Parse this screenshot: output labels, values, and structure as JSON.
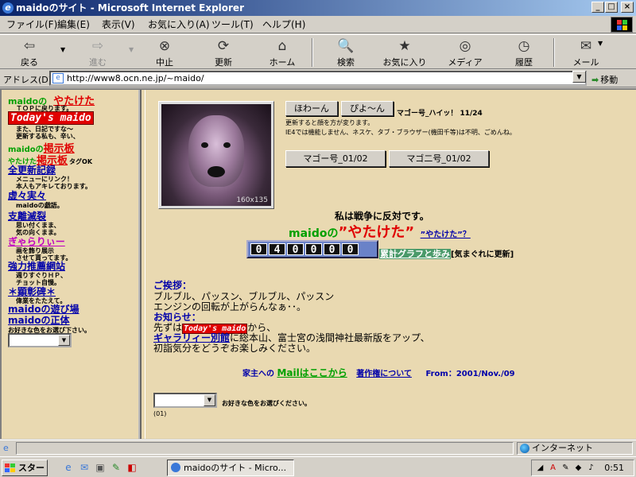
{
  "window": {
    "title": "maidoのサイト - Microsoft Internet Explorer",
    "min": "_",
    "max": "□",
    "close": "×"
  },
  "menu": [
    "ファイル(F)",
    "編集(E)",
    "表示(V)",
    "お気に入り(A)",
    "ツール(T)",
    "ヘルプ(H)"
  ],
  "toolbar": {
    "back": "戻る",
    "forward": "進む",
    "stop": "中止",
    "refresh": "更新",
    "home": "ホーム",
    "search": "検索",
    "favorites": "お気に入り",
    "media": "メディア",
    "history": "履歴",
    "mail": "メール"
  },
  "address": {
    "label": "アドレス(D)",
    "url": "http://www8.ocn.ne.jp/~maido/",
    "go": "移動"
  },
  "sidebar": {
    "maido_no": "maidoの",
    "yatageta": "やたけた",
    "top_desc": "ＴＯＰに戻ります。",
    "today_badge": "Today's maido",
    "today_desc1": "また、日記ですな～",
    "today_desc2": "更新する私も、辛い、",
    "bbs_prefix": "maidoの",
    "bbs": "掲示板",
    "bbs2_prefix": "やたけた",
    "bbs2": "掲示板",
    "bbs2_suffix": "タグOK",
    "new_records": "全更新記録",
    "new_records_desc1": "メニューにリンク！",
    "new_records_desc2": "本人もアキレております。",
    "toraba": "虚々実々",
    "toraba_desc": "maidoの戯語。",
    "shiri": "支離滅裂",
    "shiri_desc1": "思い付くまま、",
    "shiri_desc2": "気の向くまま。",
    "gallery": "ぎゃらりぃー",
    "gallery_desc1": "画を飾り展示",
    "gallery_desc2": "させて貰ってます。",
    "links": "強力推薦網站",
    "links_desc1": "週りすぐりＨＰ、",
    "links_desc2": "チョット自慢。",
    "kenshou": "＊顕彰碑＊",
    "kenshou_desc": "偉業をたたえて。",
    "asobiba": "maidoの遊び場",
    "shoutai": "maidoの正体",
    "color_select": "お好きな色をお選び下さい。"
  },
  "main": {
    "photo_size": "160x135",
    "btn_hawan": "ほわーん",
    "btn_piyon": "ぴよ～ん",
    "mago_hi": "マゴー号_ハイッ！ 11/24",
    "update_note1": "更新すると顔を方が変ります。",
    "update_note2": "IE4では機能しません、ネスケ、タブ・ブラウザー(機田千等)は不明、ごめんね。",
    "btn_mago1": "マゴー号_01/02",
    "btn_mago2": "マゴ二号_01/02",
    "war": "私は戦争に反対です。",
    "maido_no": "maidoの",
    "yatageta_q1": "”やたけた”",
    "yatageta_link": "”やたけた”？",
    "counter_digits": [
      "0",
      "4",
      "0",
      "0",
      "0",
      "0"
    ],
    "graph_link": "累計グラフと歩み",
    "graph_note": "[気まぐれに更新]",
    "greeting_head": "ご挨拶：",
    "greeting1": "ブルブル、パッスン、ブルブル、パッスン",
    "greeting2": "エンジンの回転が上がらんなぁ･･。",
    "notice_head": "お知らせ：",
    "notice1_pre": "先ずは",
    "notice1_badge": "Today's maido",
    "notice1_post": "から、",
    "gallery_link": "ギャラリィー別館",
    "notice2_post": "に総本山、富士宮の浅間神社最新版をアップ、",
    "notice3": "初詣気分をどうぞお楽しみください。",
    "mail_prefix": "家主への",
    "mail_link": "Mailはここから",
    "copyright_link": "著作権について",
    "from": "From：2001/Nov./09",
    "color_select": "お好きな色をお選びください。",
    "footnote": "(01)"
  },
  "status": {
    "zone": "インターネット"
  },
  "taskbar": {
    "start": "スタート",
    "task": "maidoのサイト - Micro...",
    "clock": "0:51"
  }
}
